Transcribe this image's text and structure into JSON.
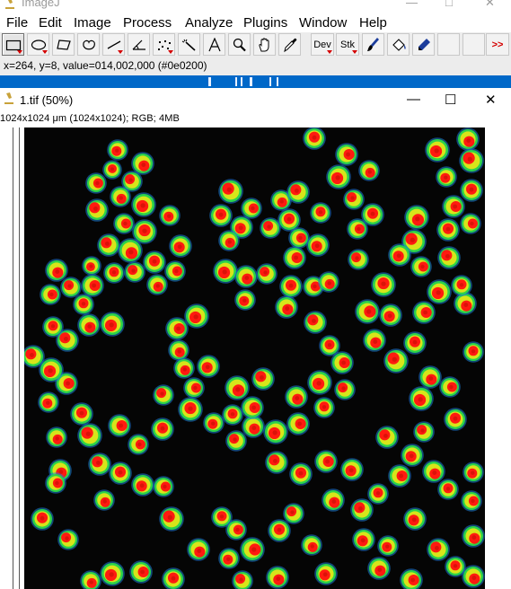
{
  "app": {
    "title": "ImageJ"
  },
  "menu": [
    "File",
    "Edit",
    "Image",
    "Process",
    "Analyze",
    "Plugins",
    "Window",
    "Help"
  ],
  "toolbar": {
    "tools": [
      {
        "name": "rectangle-tool-button",
        "icon": "rectangle-icon",
        "selected": true
      },
      {
        "name": "oval-tool-button",
        "icon": "oval-icon"
      },
      {
        "name": "polygon-tool-button",
        "icon": "polygon-icon"
      },
      {
        "name": "freehand-tool-button",
        "icon": "freehand-icon"
      },
      {
        "name": "line-tool-button",
        "icon": "line-icon"
      },
      {
        "name": "angle-tool-button",
        "icon": "angle-icon"
      },
      {
        "name": "multipoint-tool-button",
        "icon": "multipoint-icon"
      },
      {
        "name": "wand-tool-button",
        "icon": "wand-icon"
      },
      {
        "name": "text-tool-button",
        "icon": "text-icon"
      },
      {
        "name": "magnifier-tool-button",
        "icon": "magnifier-icon"
      },
      {
        "name": "hand-tool-button",
        "icon": "hand-icon"
      },
      {
        "name": "dropper-tool-button",
        "icon": "dropper-icon"
      }
    ],
    "dev_label": "Dev",
    "stk_label": "Stk",
    "more_label": ">>"
  },
  "status": {
    "text": "x=264, y=8, value=014,002,000 (#0e0200)"
  },
  "image_window": {
    "title": "1.tif (50%)",
    "info": "1024x1024 μm (1024x1024); RGB; 4MB"
  },
  "colors": {
    "cell_outer": "#2bd34a",
    "cell_ring": "#d7e51a",
    "cell_core": "#ff1a10",
    "cell_edge": "#1b7bd6",
    "background": "#050505"
  }
}
